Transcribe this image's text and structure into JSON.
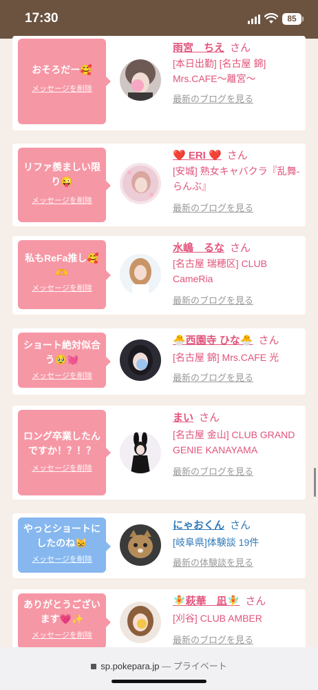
{
  "status_bar": {
    "time": "17:30",
    "battery": "85"
  },
  "colors": {
    "status_bar_bg": "#6b5340",
    "page_bg": "#f6eee8",
    "pink": "#f697a5",
    "blue_bubble": "#86b7ef",
    "pink_text": "#e1537a",
    "blue_text": "#2f7ab8"
  },
  "cards": [
    {
      "message": "おそろだー🥰",
      "delete_label": "メッセージを削除",
      "name": "雨宮　ちえ",
      "suffix": "さん",
      "shop": "[本日出勤] [名古屋 錦] Mrs.CAFE〜離宮〜",
      "link": "最新のブログを見る"
    },
    {
      "message": "リファ羨ましい限り😜",
      "delete_label": "メッセージを削除",
      "name": "❤️ ERI ❤️",
      "suffix": "さん",
      "shop": "[安城] 熟女キャバクラ『乱舞-らんぶ』",
      "link": "最新のブログを見る"
    },
    {
      "message": "私もReFa推し🥰🫶",
      "delete_label": "メッセージを削除",
      "name": "水嶋　るな",
      "suffix": "さん",
      "shop": "[名古屋 瑞穂区] CLUB CameRia",
      "link": "最新のブログを見る"
    },
    {
      "message": "ショート絶対似合う🥹💓",
      "delete_label": "メッセージを削除",
      "name": "🐣西園寺 ひな🐣",
      "suffix": "さん",
      "shop": "[名古屋 錦] Mrs.CAFE 光",
      "link": "最新のブログを見る"
    },
    {
      "message": "ロング卒業したんですか！？！？",
      "delete_label": "メッセージを削除",
      "name": "まい",
      "suffix": "さん",
      "shop": "[名古屋 金山] CLUB GRAND GENIE KANAYAMA",
      "link": "最新のブログを見る"
    },
    {
      "message": "やっとショートにしたのね😸",
      "delete_label": "メッセージを削除",
      "name": "にゃおくん",
      "suffix": "さん",
      "shop": "[岐阜県]体験談 19件",
      "link": "最新の体験談を見る"
    },
    {
      "message": "ありがとうございます💗✨",
      "delete_label": "メッセージを削除",
      "name": "🧚萩華　凪🧚",
      "suffix": "さん",
      "shop": "[刈谷] CLUB AMBER",
      "link": "最新のブログを見る"
    }
  ],
  "url_bar": {
    "domain": "sp.pokepara.jp",
    "mode": "— プライベート"
  }
}
